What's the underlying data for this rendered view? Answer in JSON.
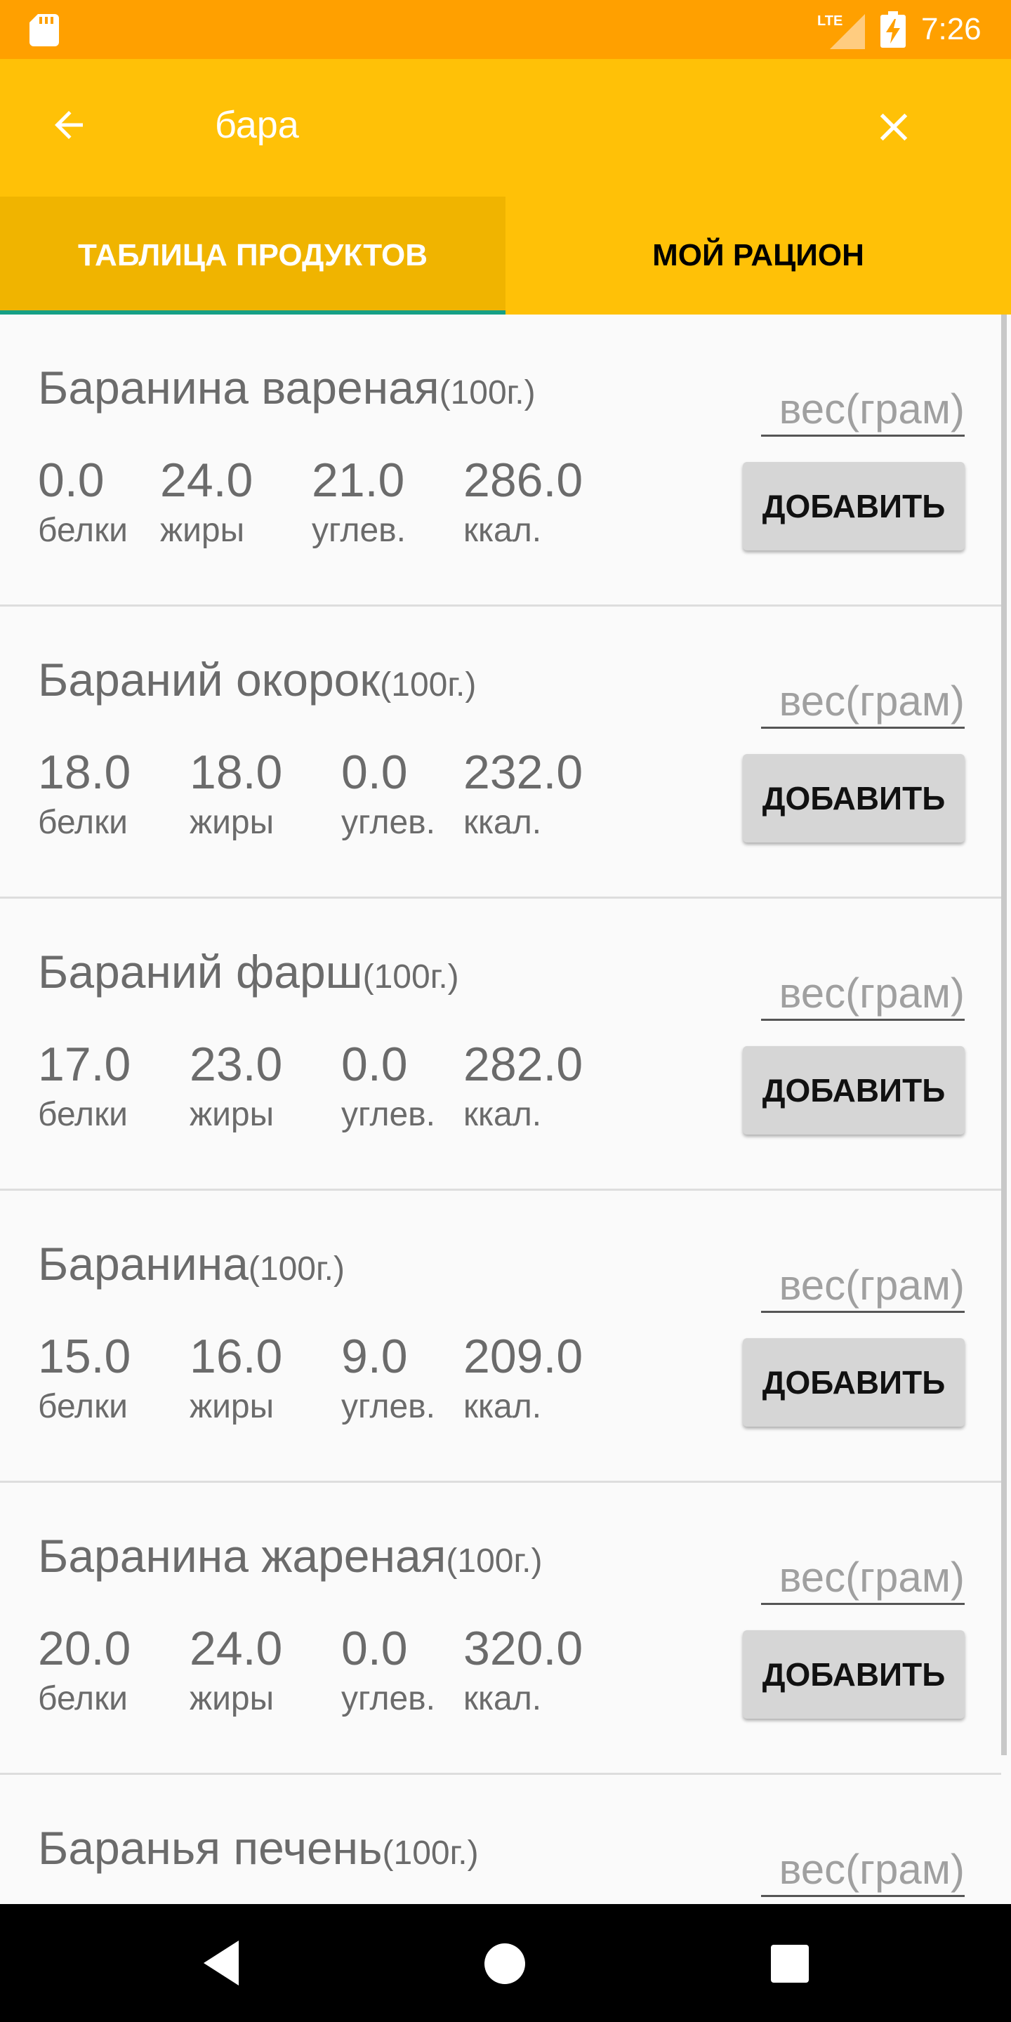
{
  "status_bar": {
    "time": "7:26",
    "network_label": "LTE",
    "icons": [
      "sd-card-icon",
      "signal-icon",
      "battery-charging-icon"
    ]
  },
  "app_bar": {
    "search_value": "бара",
    "icons": [
      "arrow-back-icon",
      "close-icon"
    ]
  },
  "tabs": [
    {
      "label": "ТАБЛИЦА ПРОДУКТОВ",
      "selected": true
    },
    {
      "label": "МОЙ РАЦИОН",
      "selected": false
    }
  ],
  "colors": {
    "status_bar": "#ffa000",
    "app_bar": "#ffc107",
    "selected_tab": "#f0b400",
    "tab_indicator": "#16a085"
  },
  "labels": {
    "protein": "белки",
    "fat": "жиры",
    "carbs": "углев.",
    "kcal": "ккал.",
    "unit": "(100г.)",
    "weight_placeholder": "вес(грам)",
    "add_button": "ДОБАВИТЬ"
  },
  "items": [
    {
      "name": "Баранина вареная",
      "protein": "0.0",
      "fat": "24.0",
      "carbs": "21.0",
      "kcal": "286.0"
    },
    {
      "name": "Бараний окорок",
      "protein": "18.0",
      "fat": "18.0",
      "carbs": "0.0",
      "kcal": "232.0"
    },
    {
      "name": "Бараний фарш",
      "protein": "17.0",
      "fat": "23.0",
      "carbs": "0.0",
      "kcal": "282.0"
    },
    {
      "name": "Баранина",
      "protein": "15.0",
      "fat": "16.0",
      "carbs": "9.0",
      "kcal": "209.0"
    },
    {
      "name": "Баранина жареная",
      "protein": "20.0",
      "fat": "24.0",
      "carbs": "0.0",
      "kcal": "320.0"
    },
    {
      "name": "Баранья печень"
    }
  ],
  "nav_bar": {
    "icons": [
      "nav-back-icon",
      "nav-home-icon",
      "nav-recents-icon"
    ]
  }
}
